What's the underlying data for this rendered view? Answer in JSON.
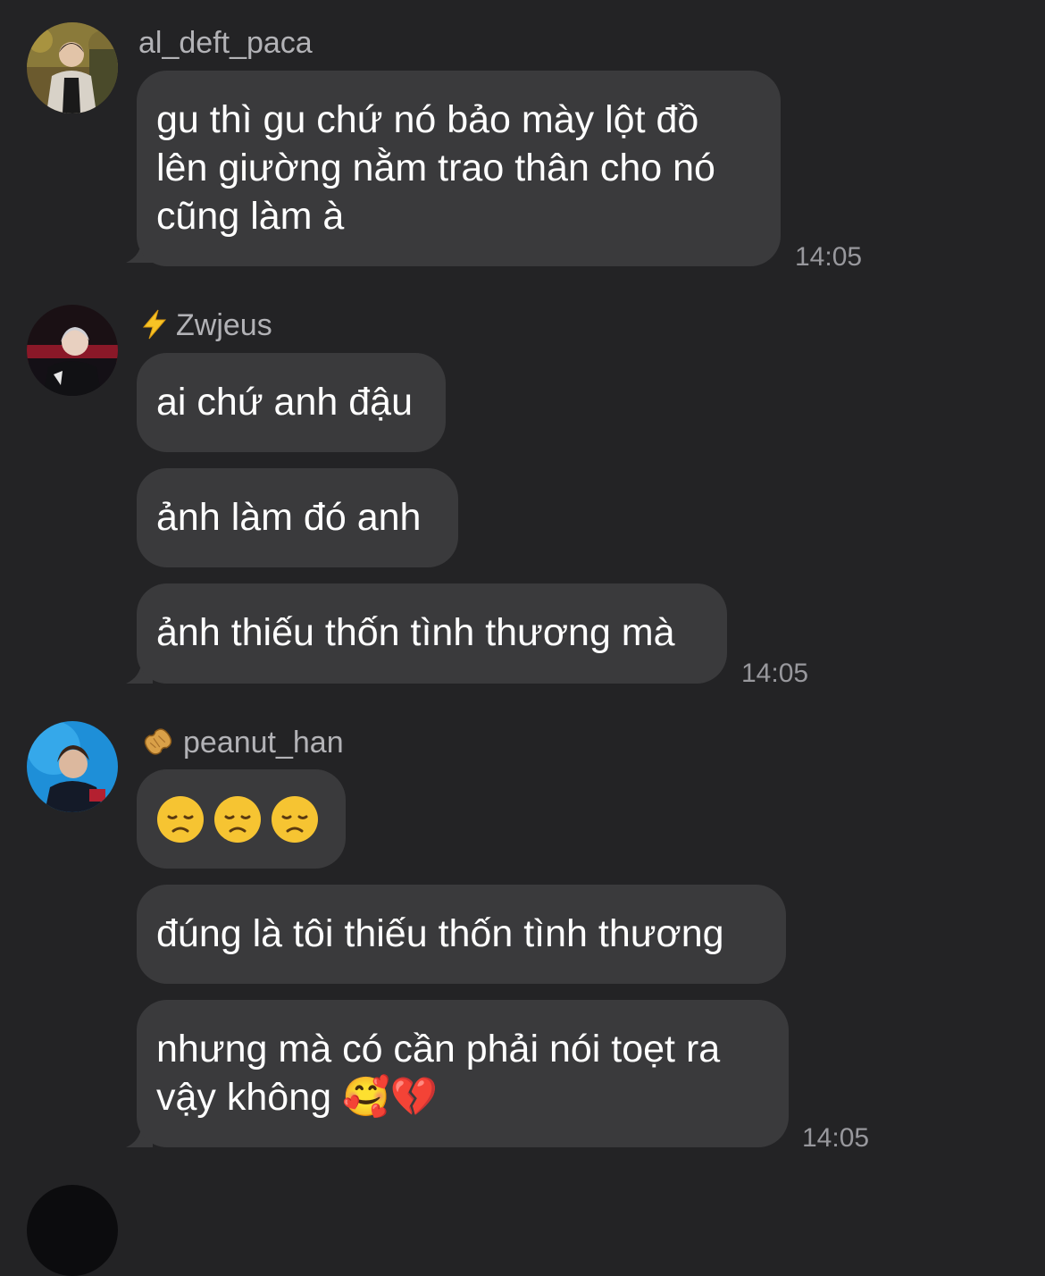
{
  "messages": [
    {
      "sender": "al_deft_paca",
      "badge": "",
      "time": "14:05",
      "bubbles": [
        "gu thì gu chứ nó bảo mày lột đồ\nlên giường nằm trao thân cho nó\ncũng làm à"
      ]
    },
    {
      "sender": "Zwjeus",
      "badge": "lightning-icon",
      "time": "14:05",
      "bubbles": [
        "ai chứ anh đậu",
        "ảnh làm đó anh",
        "ảnh thiếu thốn tình thương mà"
      ]
    },
    {
      "sender": "peanut_han",
      "badge": "peanut-icon",
      "time": "14:05",
      "bubbles": [
        "😞😞😞",
        "đúng là tôi thiếu thốn tình thương",
        "nhưng mà có cần phải nói toẹt ra\nvậy không 🥰💔"
      ]
    }
  ],
  "colors": {
    "background": "#232325",
    "bubble": "#3a3a3c",
    "sender": "#b2b2b6",
    "timestamp": "#98989d"
  }
}
